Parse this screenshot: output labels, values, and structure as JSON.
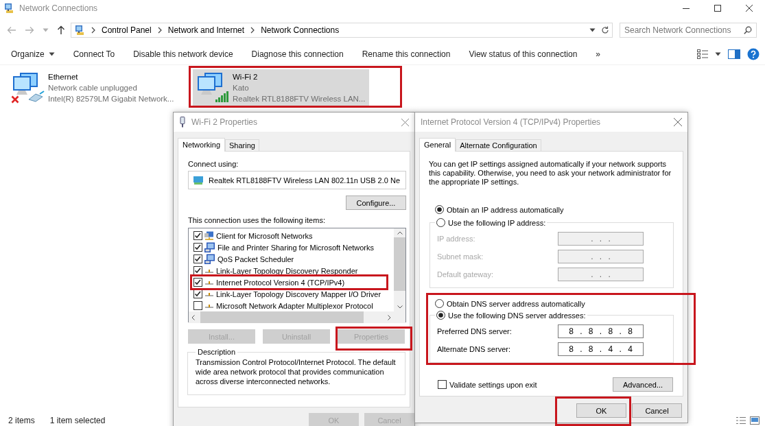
{
  "window": {
    "title": "Network Connections"
  },
  "address_bar": {
    "path": [
      "Control Panel",
      "Network and Internet",
      "Network Connections"
    ]
  },
  "search": {
    "placeholder": "Search Network Connections"
  },
  "toolbar": [
    {
      "label": "Organize",
      "dropdown": true
    },
    {
      "label": "Connect To",
      "dropdown": false
    },
    {
      "label": "Disable this network device",
      "dropdown": false
    },
    {
      "label": "Diagnose this connection",
      "dropdown": false
    },
    {
      "label": "Rename this connection",
      "dropdown": false
    },
    {
      "label": "View status of this connection",
      "dropdown": false
    }
  ],
  "toolbar_more": "»",
  "connections": [
    {
      "kind": "ethernet",
      "name": "Ethernet",
      "status": "Network cable unplugged",
      "adapter": "Intel(R) 82579LM Gigabit Network...",
      "connected": false,
      "selected": false,
      "highlighted": false
    },
    {
      "kind": "wifi",
      "name": "Wi-Fi 2",
      "status": "Kato",
      "adapter": "Realtek RTL8188FTV Wireless LAN...",
      "connected": true,
      "selected": true,
      "highlighted": true
    }
  ],
  "status_bar": {
    "count": "2 items",
    "selection": "1 item selected"
  },
  "wifi_properties": {
    "title": "Wi-Fi 2 Properties",
    "tabs": [
      {
        "label": "Networking",
        "selected": true
      },
      {
        "label": "Sharing",
        "selected": false
      }
    ],
    "connect_using_label": "Connect using:",
    "adapter": "Realtek RTL8188FTV Wireless LAN 802.11n USB 2.0 Ne",
    "configure_button": "Configure...",
    "items_label": "This connection uses the following items:",
    "items": [
      {
        "kind": "client",
        "label": "Client for Microsoft Networks",
        "checked": true,
        "highlighted": false
      },
      {
        "kind": "service",
        "label": "File and Printer Sharing for Microsoft Networks",
        "checked": true,
        "highlighted": false
      },
      {
        "kind": "service",
        "label": "QoS Packet Scheduler",
        "checked": true,
        "highlighted": false
      },
      {
        "kind": "protocol",
        "label": "Link-Layer Topology Discovery Responder",
        "checked": true,
        "highlighted": false
      },
      {
        "kind": "protocol",
        "label": "Internet Protocol Version 4 (TCP/IPv4)",
        "checked": true,
        "highlighted": true
      },
      {
        "kind": "protocol",
        "label": "Link-Layer Topology Discovery Mapper I/O Driver",
        "checked": true,
        "highlighted": false
      },
      {
        "kind": "protocol",
        "label": "Microsoft Network Adapter Multiplexor Protocol",
        "checked": false,
        "highlighted": false
      }
    ],
    "item_buttons": [
      {
        "label": "Install...",
        "disabled": true,
        "highlighted": false
      },
      {
        "label": "Uninstall",
        "disabled": true,
        "highlighted": false
      },
      {
        "label": "Properties",
        "disabled": true,
        "highlighted": true
      }
    ],
    "description": {
      "title": "Description",
      "text": "Transmission Control Protocol/Internet Protocol. The default wide area network protocol that provides communication across diverse interconnected networks."
    },
    "buttons": [
      {
        "label": "OK",
        "disabled": true
      },
      {
        "label": "Cancel",
        "disabled": true
      }
    ]
  },
  "ipv4_properties": {
    "title": "Internet Protocol Version 4 (TCP/IPv4) Properties",
    "tabs": [
      {
        "label": "General",
        "selected": true
      },
      {
        "label": "Alternate Configuration",
        "selected": false
      }
    ],
    "intro": "You can get IP settings assigned automatically if your network supports this capability. Otherwise, you need to ask your network administrator for the appropriate IP settings.",
    "ip_options": [
      {
        "label": "Obtain an IP address automatically",
        "selected": true
      },
      {
        "label": "Use the following IP address:",
        "selected": false
      }
    ],
    "ip_fields": [
      {
        "label": "IP address:",
        "value": ". . .",
        "disabled": true
      },
      {
        "label": "Subnet mask:",
        "value": ". . .",
        "disabled": true
      },
      {
        "label": "Default gateway:",
        "value": ". . .",
        "disabled": true
      }
    ],
    "dns_highlighted": true,
    "dns_options": [
      {
        "label": "Obtain DNS server address automatically",
        "selected": false
      },
      {
        "label": "Use the following DNS server addresses:",
        "selected": true
      }
    ],
    "dns_fields": [
      {
        "label": "Preferred DNS server:",
        "value": "8 . 8 . 8 . 8",
        "disabled": false
      },
      {
        "label": "Alternate DNS server:",
        "value": "8 . 8 . 4 . 4",
        "disabled": false
      }
    ],
    "validate": {
      "label": "Validate settings upon exit",
      "checked": false
    },
    "advanced_button": "Advanced...",
    "buttons": [
      {
        "label": "OK",
        "disabled": false,
        "highlighted": true
      },
      {
        "label": "Cancel",
        "disabled": false,
        "highlighted": false
      }
    ]
  }
}
